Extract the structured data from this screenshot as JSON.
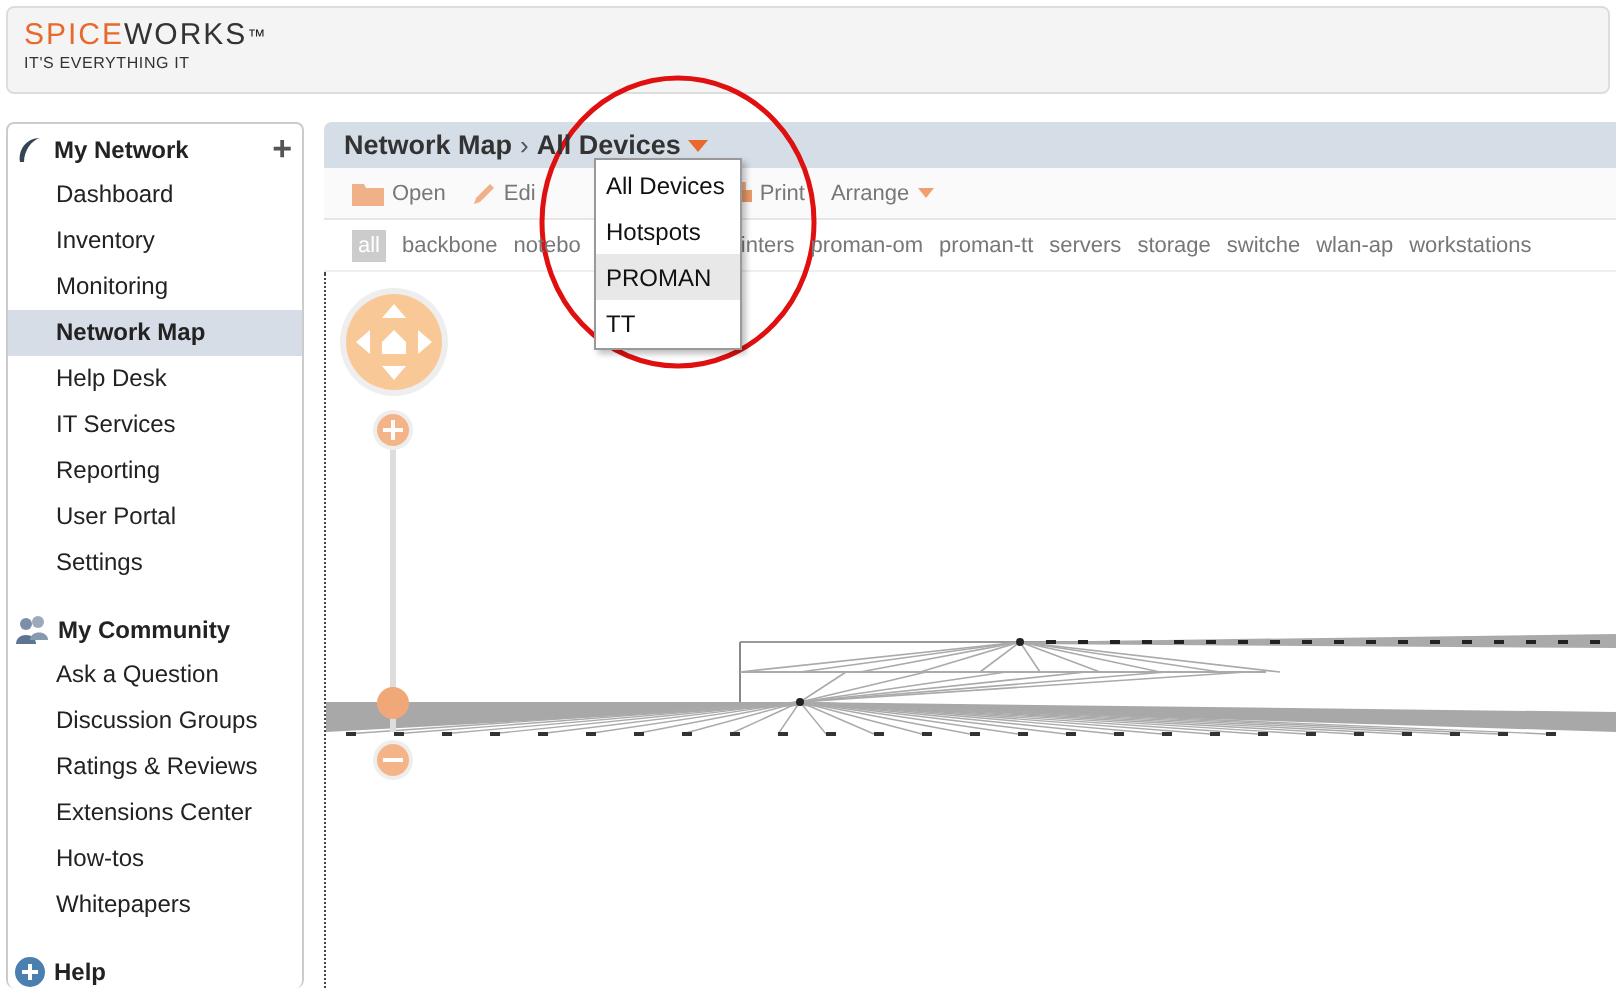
{
  "logo": {
    "brand_left": "SPICE",
    "brand_right": "WORKS",
    "mark": "™",
    "tagline": "IT'S EVERYTHING IT"
  },
  "sidebar": {
    "sections": [
      {
        "kind": "network",
        "title": "My Network",
        "add": "+",
        "items": [
          {
            "label": "Dashboard",
            "selected": false
          },
          {
            "label": "Inventory",
            "selected": false
          },
          {
            "label": "Monitoring",
            "selected": false
          },
          {
            "label": "Network Map",
            "selected": true
          },
          {
            "label": "Help Desk",
            "selected": false
          },
          {
            "label": "IT Services",
            "selected": false
          },
          {
            "label": "Reporting",
            "selected": false
          },
          {
            "label": "User Portal",
            "selected": false
          },
          {
            "label": "Settings",
            "selected": false
          }
        ]
      },
      {
        "kind": "community",
        "title": "My Community",
        "items": [
          {
            "label": "Ask a Question",
            "selected": false
          },
          {
            "label": "Discussion Groups",
            "selected": false
          },
          {
            "label": "Ratings & Reviews",
            "selected": false
          },
          {
            "label": "Extensions Center",
            "selected": false
          },
          {
            "label": "How-tos",
            "selected": false
          },
          {
            "label": "Whitepapers",
            "selected": false
          }
        ]
      },
      {
        "kind": "help",
        "title": "Help"
      }
    ]
  },
  "panel": {
    "title": "Network Map",
    "separator": "›",
    "view": "All Devices",
    "toolbar_before_menu": [
      {
        "kind": "open",
        "label": "Open"
      },
      {
        "kind": "edit",
        "label": "Edi"
      }
    ],
    "toolbar_after_menu": [
      {
        "kind": "print",
        "label": "Print"
      },
      {
        "kind": "arrange",
        "label": "Arrange"
      }
    ],
    "tags_before_menu": [
      {
        "label": "all",
        "selected": true
      },
      {
        "label": "backbone",
        "selected": false
      },
      {
        "label": "notebo",
        "selected": false
      }
    ],
    "tags_after_menu": [
      {
        "label": "inters",
        "selected": false
      },
      {
        "label": "proman-om",
        "selected": false
      },
      {
        "label": "proman-tt",
        "selected": false
      },
      {
        "label": "servers",
        "selected": false
      },
      {
        "label": "storage",
        "selected": false
      },
      {
        "label": "switche",
        "selected": false
      },
      {
        "label": "wlan-ap",
        "selected": false
      },
      {
        "label": "workstations",
        "selected": false
      }
    ],
    "zoom_slider": {
      "level": 0.05
    },
    "view_menu": [
      {
        "label": "All Devices",
        "selected": false
      },
      {
        "label": "Hotspots",
        "selected": false
      },
      {
        "label": "PROMAN",
        "selected": true
      },
      {
        "label": "TT",
        "selected": false
      }
    ]
  }
}
